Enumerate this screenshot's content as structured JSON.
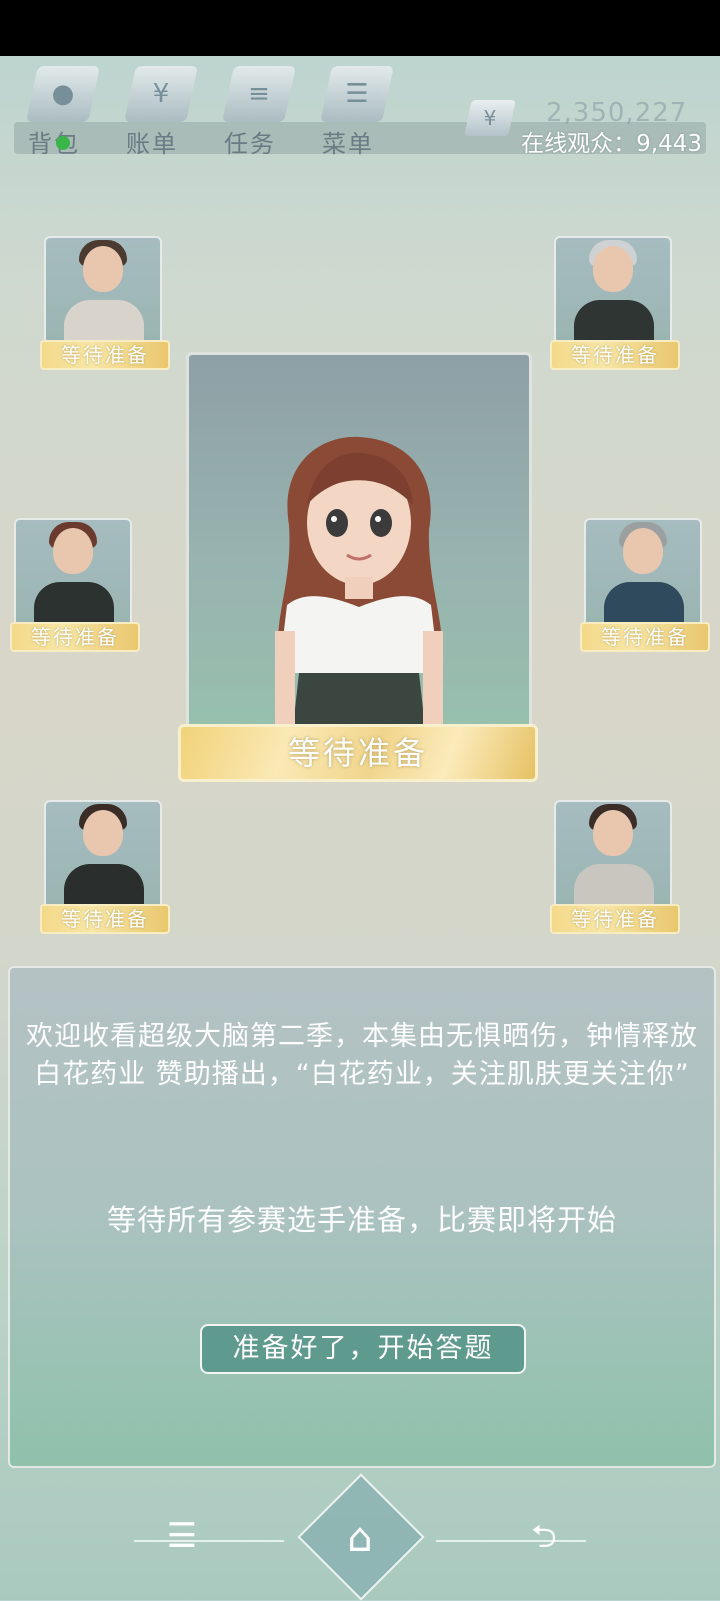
{
  "topbar": {
    "items": [
      {
        "label": "背包",
        "icon": "backpack-icon"
      },
      {
        "label": "账单",
        "icon": "bill-icon"
      },
      {
        "label": "任务",
        "icon": "task-icon"
      },
      {
        "label": "菜单",
        "icon": "menu-icon"
      }
    ],
    "money": "2,350,227",
    "currency_glyph": "¥",
    "viewers": "在线观众：9,443"
  },
  "players": [
    {
      "id": "top-left",
      "status": "等待准备"
    },
    {
      "id": "top-right",
      "status": "等待准备"
    },
    {
      "id": "mid-left",
      "status": "等待准备"
    },
    {
      "id": "mid-right",
      "status": "等待准备"
    },
    {
      "id": "bottom-left",
      "status": "等待准备"
    },
    {
      "id": "bottom-right",
      "status": "等待准备"
    }
  ],
  "main_player": {
    "status": "等待准备"
  },
  "dialog": {
    "message": "欢迎收看超级大脑第二季，本集由无惧晒伤，钟情释放 白花药业 赞助播出，“白花药业，关注肌肤更关注你”",
    "sub_message": "等待所有参赛选手准备，比赛即将开始",
    "ready_button": "准备好了，开始答题"
  },
  "navbar": {
    "menu_glyph": "☰",
    "home_glyph": "⌂",
    "back_glyph": "⮌"
  },
  "colors": {
    "gold": "#f2d27a",
    "teal_button": "#4b8c82",
    "badge_green": "#39b54a"
  }
}
